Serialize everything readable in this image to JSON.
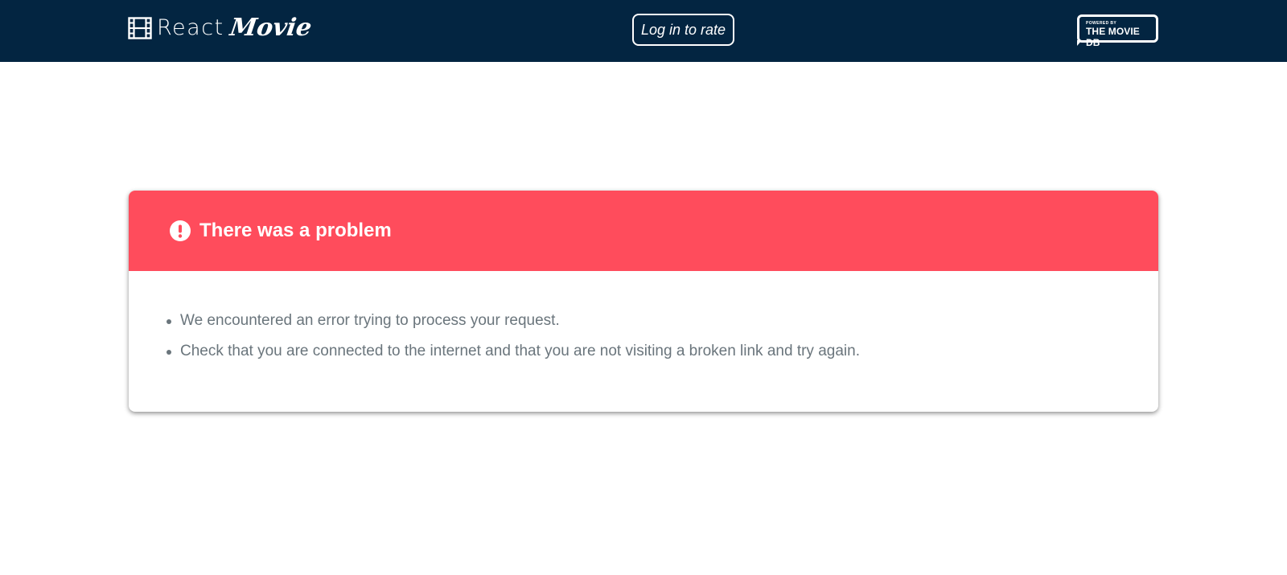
{
  "nav": {
    "brand_react": "React",
    "brand_movie": "Movie",
    "brand_icon": "film-icon",
    "login_label": "Log in to rate",
    "tmdb_small": "POWERED BY",
    "tmdb_big": "THE MOVIE DB"
  },
  "error": {
    "icon": "exclamation-circle-icon",
    "title": "There was a problem",
    "messages": [
      "We encountered an error trying to process your request.",
      "Check that you are connected to the internet and that you are not visiting a broken link and try again."
    ]
  },
  "colors": {
    "navbar": "#032541",
    "alert_header": "#ff4c5c",
    "body_text": "#6a757c"
  }
}
